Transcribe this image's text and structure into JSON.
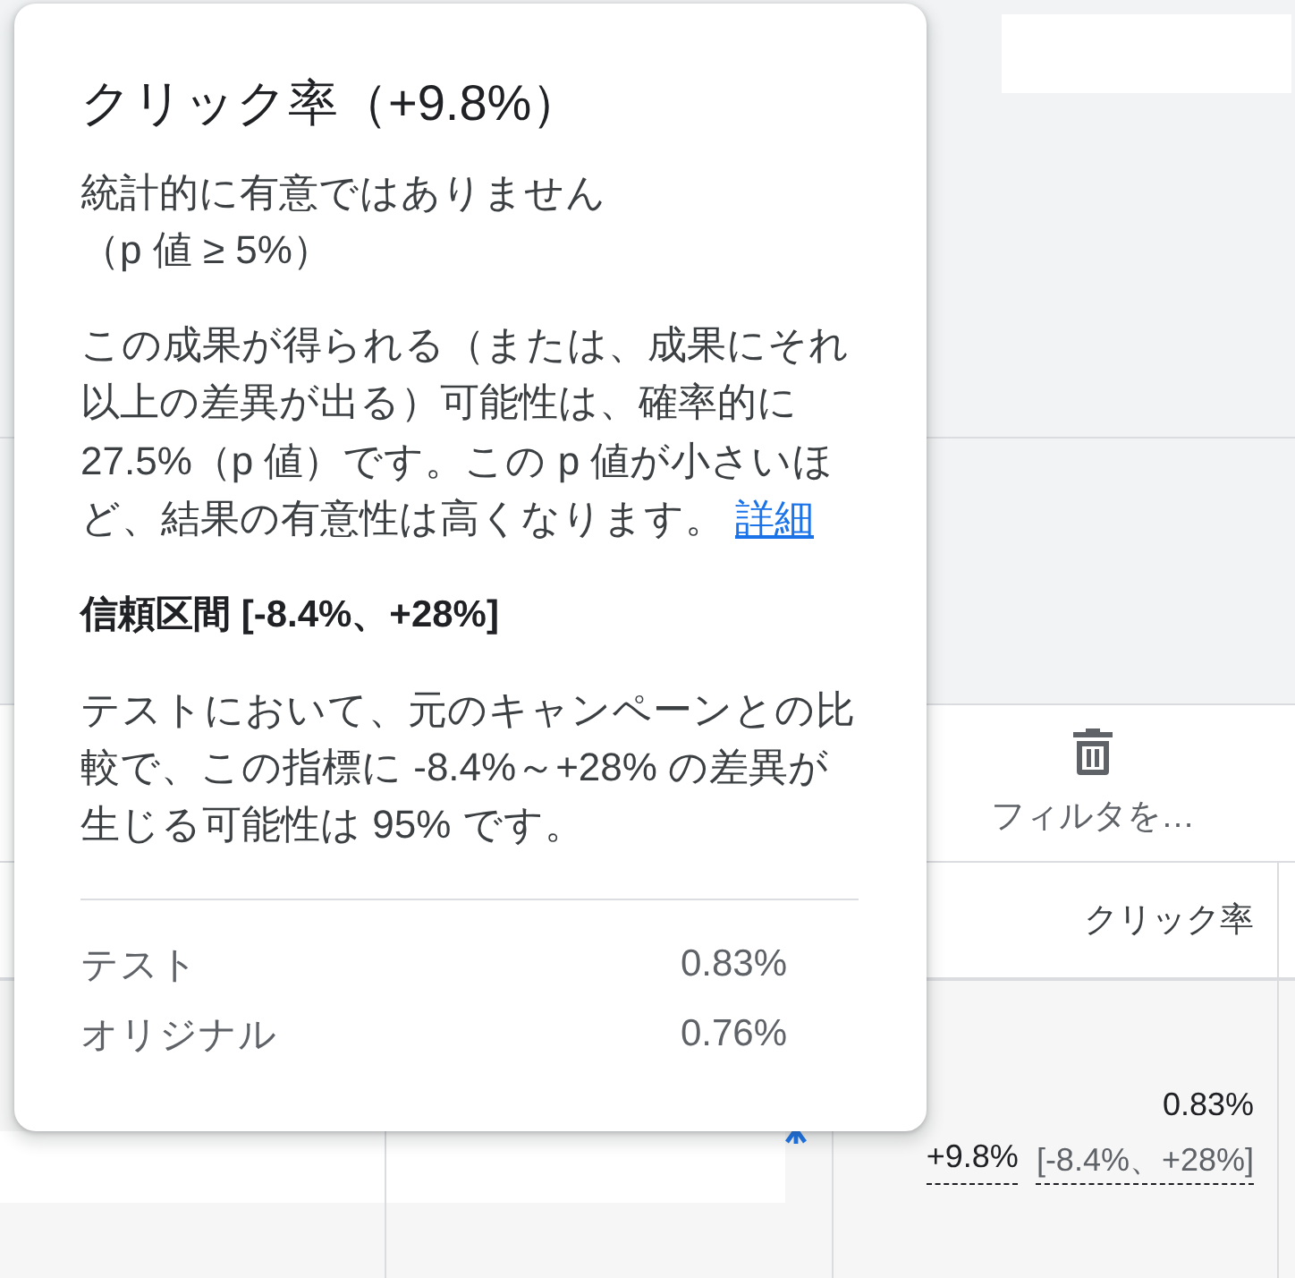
{
  "tooltip": {
    "title": "クリック率（+9.8%）",
    "status_lines": [
      "統計的に有意ではありません",
      "（p 値 ≥ 5%）"
    ],
    "explanation": "この成果が得られる（または、成果にそれ以上の差異が出る）可能性は、確率的に 27.5%（p 値）です。この p 値が小さいほど、結果の有意性は高くなります。",
    "link": "詳細",
    "interval_heading": "信頼区間 [-8.4%、+28%]",
    "interval_text": "テストにおいて、元のキャンペーンとの比較で、この指標に -8.4%～+28% の差異が生じる可能性は 95% です。",
    "comparison": [
      {
        "label": "テスト",
        "value": "0.83%"
      },
      {
        "label": "オリジナル",
        "value": "0.76%"
      }
    ]
  },
  "toolbar": {
    "buttons": [
      {
        "label": "フィルタを…"
      }
    ]
  },
  "table": {
    "columns": [
      {
        "label": "クリック率"
      }
    ],
    "rows": [
      {
        "value": "0.83%",
        "change": "+9.8%",
        "interval": "[-8.4%、+28%]"
      }
    ]
  }
}
